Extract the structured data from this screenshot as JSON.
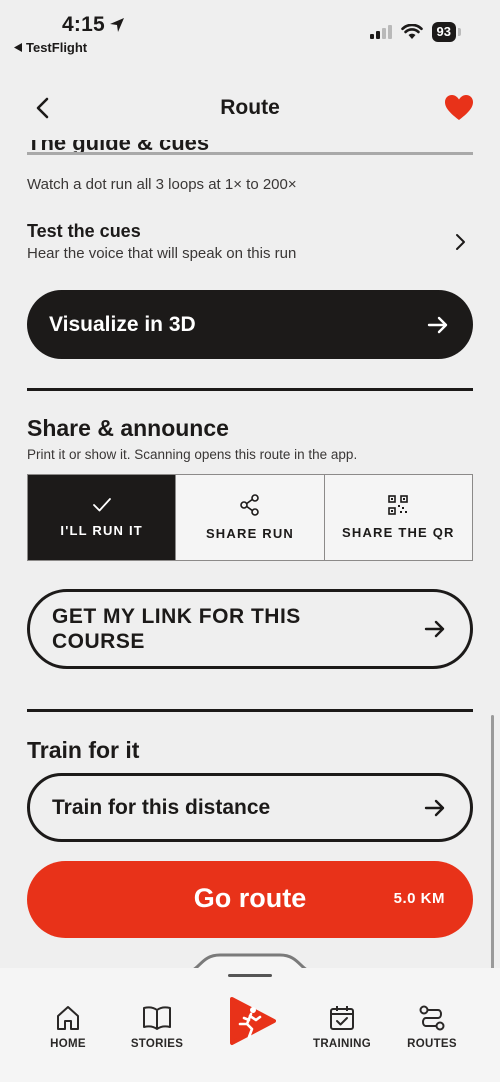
{
  "status_bar": {
    "time": "4:15",
    "back_app": "TestFlight",
    "battery": "93"
  },
  "header": {
    "title": "Route"
  },
  "guide": {
    "cut_heading": "The guide & cues",
    "subtitle": "Watch a dot run all 3 loops at 1× to 200×"
  },
  "test_cues": {
    "title": "Test the cues",
    "subtitle": "Hear the voice that will speak on this run"
  },
  "visualize_button": {
    "label": "Visualize in 3D"
  },
  "share": {
    "title": "Share & announce",
    "subtitle": "Print it or show it. Scanning opens this route in the app.",
    "options": [
      {
        "label": "I'LL RUN IT",
        "icon": "check-icon",
        "active": true
      },
      {
        "label": "SHARE RUN",
        "icon": "share-icon",
        "active": false
      },
      {
        "label": "SHARE THE QR",
        "icon": "qr-icon",
        "active": false
      }
    ],
    "link_button_line1": "GET MY LINK FOR THIS",
    "link_button_line2": "COURSE"
  },
  "train": {
    "title": "Train for it",
    "button_label": "Train for this distance"
  },
  "go": {
    "label": "Go route",
    "distance": "5.0 KM"
  },
  "nav": {
    "items": [
      {
        "label": "HOME",
        "icon": "home-icon"
      },
      {
        "label": "STORIES",
        "icon": "book-icon"
      },
      {
        "label": "TRAINING",
        "icon": "calendar-check-icon"
      },
      {
        "label": "ROUTES",
        "icon": "routes-icon"
      }
    ]
  },
  "colors": {
    "accent": "#e83219",
    "dark": "#1c1a19",
    "background": "#efefef"
  }
}
